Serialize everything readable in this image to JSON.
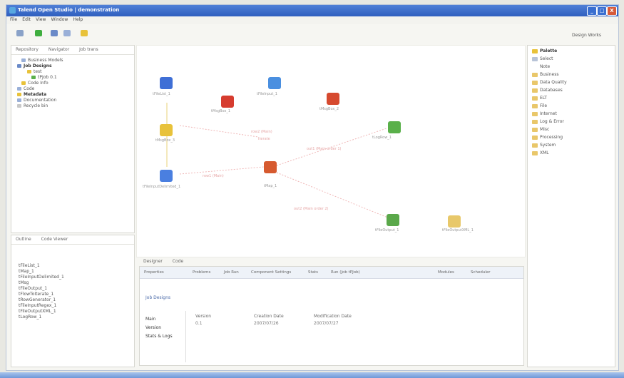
{
  "window": {
    "title": "Talend Open Studio | demonstration",
    "buttons": [
      "_",
      "□",
      "X"
    ]
  },
  "menu": [
    "File",
    "Edit",
    "View",
    "Window",
    "Help"
  ],
  "perspective": "Design Works",
  "left_panel": {
    "tabs": [
      "Repository",
      "Navigator",
      "Job trans"
    ],
    "tree": [
      {
        "label": "Business Models",
        "bold": false
      },
      {
        "label": "Job Designs",
        "bold": true
      },
      {
        "label": "test",
        "bold": false
      },
      {
        "label": "tPJob 0.1",
        "bold": false
      },
      {
        "label": "Code Info",
        "bold": false
      },
      {
        "label": "Code",
        "bold": false
      },
      {
        "label": "Metadata",
        "bold": true
      },
      {
        "label": "Documentation",
        "bold": false
      },
      {
        "label": "Recycle bin",
        "bold": false
      }
    ]
  },
  "outline_panel": {
    "tabs": [
      "Outline",
      "Code Viewer"
    ],
    "items": [
      "tFileList_1",
      "tMap_1",
      "tFileInputDelimited_1",
      "tMsg",
      "tFileOutput_1",
      "tFlowToIterate_1",
      "tRowGenerator_1",
      "tFileInputRegex_1",
      "tFileOutputXML_1",
      "tLogRow_1"
    ]
  },
  "canvas": {
    "nodes": [
      {
        "id": "n1",
        "label": "tFileList_1",
        "color": "#3f6fd6"
      },
      {
        "id": "n2",
        "label": "tMsgBox_1",
        "color": "#d63c2f"
      },
      {
        "id": "n3",
        "label": "tFileInput_1",
        "color": "#4a8fe0"
      },
      {
        "id": "n4",
        "label": "tMsgBox_2",
        "color": "#d64a2f"
      },
      {
        "id": "n5",
        "label": "tMsgBox_3",
        "color": "#e8c23a"
      },
      {
        "id": "n6",
        "label": "tLogRow_1",
        "color": "#5ab04a"
      },
      {
        "id": "n7",
        "label": "tFileInputDelimited_1",
        "color": "#4a7fe0"
      },
      {
        "id": "n8",
        "label": "tMap_1",
        "color": "#d65a2f"
      },
      {
        "id": "n9",
        "label": "tFileOutput_1",
        "color": "#5aa84a"
      },
      {
        "id": "n10",
        "label": "tFileOutputXML_1",
        "color": "#e8c86a"
      }
    ],
    "edge_labels": [
      "row1 (Main)",
      "out1 (Main order 1)",
      "row2 (Main)",
      "out2 (Main order 2)",
      "Iterate"
    ]
  },
  "bottom_panel": {
    "header_tabs": [
      "Designer",
      "Code"
    ],
    "prop_tabs": [
      "Properties",
      "Problems",
      "Job Run",
      "Component Settings",
      "Stats",
      "Run (Job tPJob)",
      "Modules",
      "Scheduler"
    ],
    "section": "Job Designs",
    "rows": [
      "Main",
      "Version",
      "Stats & Logs"
    ],
    "columns": [
      "Version",
      "Creation Date",
      "Modification Date"
    ],
    "values": [
      "0.1",
      "2007/07/26",
      "2007/07/27"
    ]
  },
  "palette": {
    "header": "Palette",
    "items": [
      "Select",
      "Note",
      "Business",
      "Data Quality",
      "Databases",
      "ELT",
      "File",
      "Internet",
      "Log & Error",
      "Misc",
      "Processing",
      "System",
      "XML"
    ]
  },
  "colors": {
    "title": "#2f5fbf",
    "accent": "#3f6fd6"
  }
}
